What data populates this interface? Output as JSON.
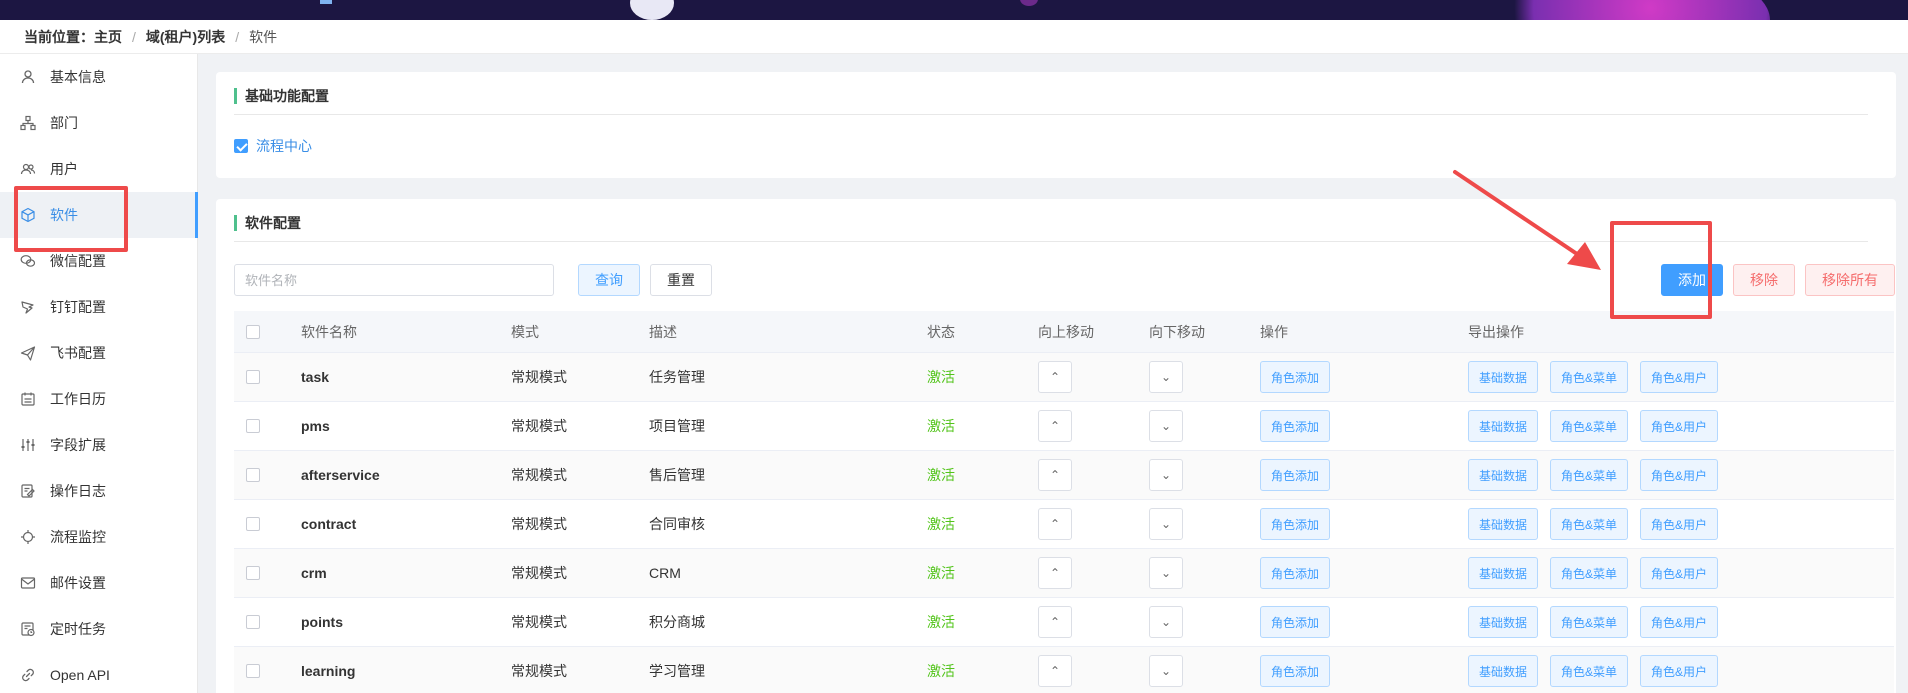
{
  "breadcrumb": {
    "lead": "当前位置：",
    "items": [
      "主页",
      "域(租户)列表",
      "软件"
    ]
  },
  "sidebar": {
    "items": [
      {
        "label": "基本信息",
        "icon": "user-icon"
      },
      {
        "label": "部门",
        "icon": "org-icon"
      },
      {
        "label": "用户",
        "icon": "users-icon"
      },
      {
        "label": "软件",
        "icon": "cube-icon",
        "active": true
      },
      {
        "label": "微信配置",
        "icon": "wechat-icon"
      },
      {
        "label": "钉钉配置",
        "icon": "dingtalk-icon"
      },
      {
        "label": "飞书配置",
        "icon": "feishu-icon"
      },
      {
        "label": "工作日历",
        "icon": "calendar-icon"
      },
      {
        "label": "字段扩展",
        "icon": "sliders-icon"
      },
      {
        "label": "操作日志",
        "icon": "log-icon"
      },
      {
        "label": "流程监控",
        "icon": "monitor-icon"
      },
      {
        "label": "邮件设置",
        "icon": "mail-icon"
      },
      {
        "label": "定时任务",
        "icon": "schedule-icon"
      },
      {
        "label": "Open API",
        "icon": "link-icon"
      }
    ]
  },
  "basic_config": {
    "title": "基础功能配置",
    "feature_label": "流程中心",
    "feature_checked": true
  },
  "software_config": {
    "title": "软件配置",
    "search_placeholder": "软件名称",
    "query_label": "查询",
    "reset_label": "重置",
    "add_label": "添加",
    "remove_label": "移除",
    "remove_all_label": "移除所有"
  },
  "table": {
    "headers": {
      "name": "软件名称",
      "mode": "模式",
      "desc": "描述",
      "status": "状态",
      "up": "向上移动",
      "down": "向下移动",
      "op": "操作",
      "export": "导出操作"
    },
    "op_label": "角色添加",
    "export_labels": [
      "基础数据",
      "角色&菜单",
      "角色&用户"
    ],
    "rows": [
      {
        "name": "task",
        "mode": "常规模式",
        "desc": "任务管理",
        "status": "激活"
      },
      {
        "name": "pms",
        "mode": "常规模式",
        "desc": "项目管理",
        "status": "激活"
      },
      {
        "name": "afterservice",
        "mode": "常规模式",
        "desc": "售后管理",
        "status": "激活"
      },
      {
        "name": "contract",
        "mode": "常规模式",
        "desc": "合同审核",
        "status": "激活"
      },
      {
        "name": "crm",
        "mode": "常规模式",
        "desc": "CRM",
        "status": "激活"
      },
      {
        "name": "points",
        "mode": "常规模式",
        "desc": "积分商城",
        "status": "激活"
      },
      {
        "name": "learning",
        "mode": "常规模式",
        "desc": "学习管理",
        "status": "激活"
      }
    ]
  }
}
